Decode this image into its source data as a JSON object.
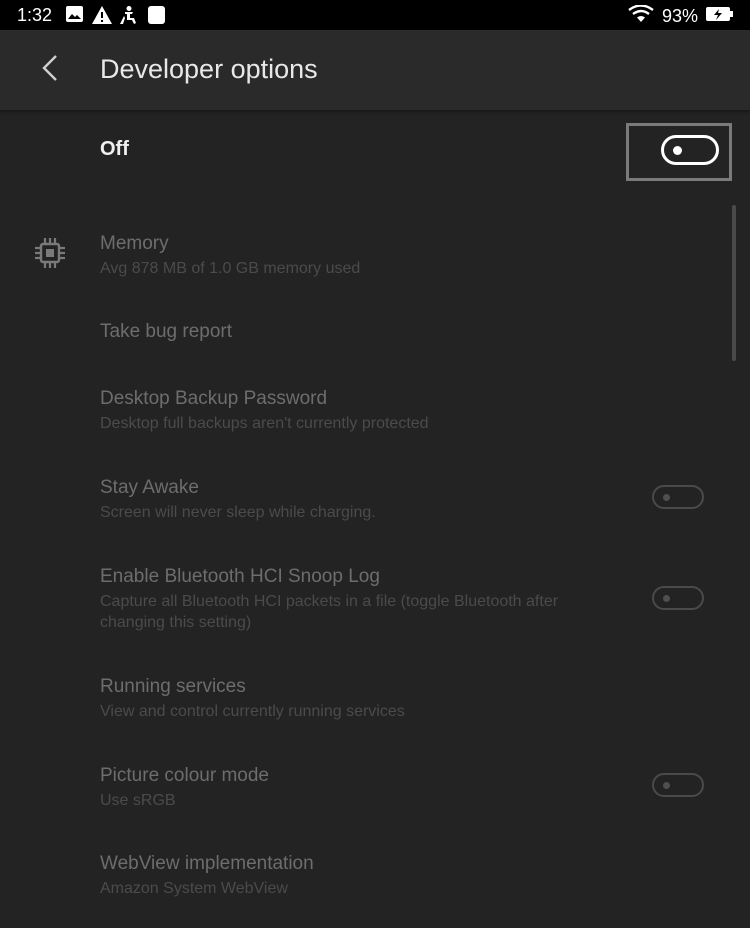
{
  "status_bar": {
    "time": "1:32",
    "battery": "93%",
    "icons": [
      "image-icon",
      "warning-icon",
      "accessibility-icon",
      "app-icon",
      "wifi-icon",
      "battery-charging-icon"
    ]
  },
  "header": {
    "title": "Developer options",
    "back_icon": "chevron-left-icon"
  },
  "master": {
    "label": "Off",
    "enabled": false
  },
  "items": [
    {
      "title": "Memory",
      "subtitle": "Avg 878 MB of 1.0 GB memory used",
      "icon": "chip-icon"
    },
    {
      "title": "Take bug report"
    },
    {
      "title": "Desktop Backup Password",
      "subtitle": "Desktop full backups aren't currently protected"
    },
    {
      "title": "Stay Awake",
      "subtitle": "Screen will never sleep while charging.",
      "toggle": false
    },
    {
      "title": "Enable Bluetooth HCI Snoop Log",
      "subtitle_line1": "Capture all Bluetooth HCI packets in a file (toggle Bluetooth after",
      "subtitle_line2": "changing this setting)",
      "toggle": false
    },
    {
      "title": "Running services",
      "subtitle": "View and control currently running services"
    },
    {
      "title": "Picture colour mode",
      "subtitle": "Use sRGB",
      "toggle": false
    },
    {
      "title": "WebView implementation",
      "subtitle": "Amazon System WebView"
    }
  ],
  "colors": {
    "background": "#232323",
    "app_bar": "#2a2a2a",
    "status_bar": "#000000",
    "disabled_text": "#6d6d6d"
  }
}
